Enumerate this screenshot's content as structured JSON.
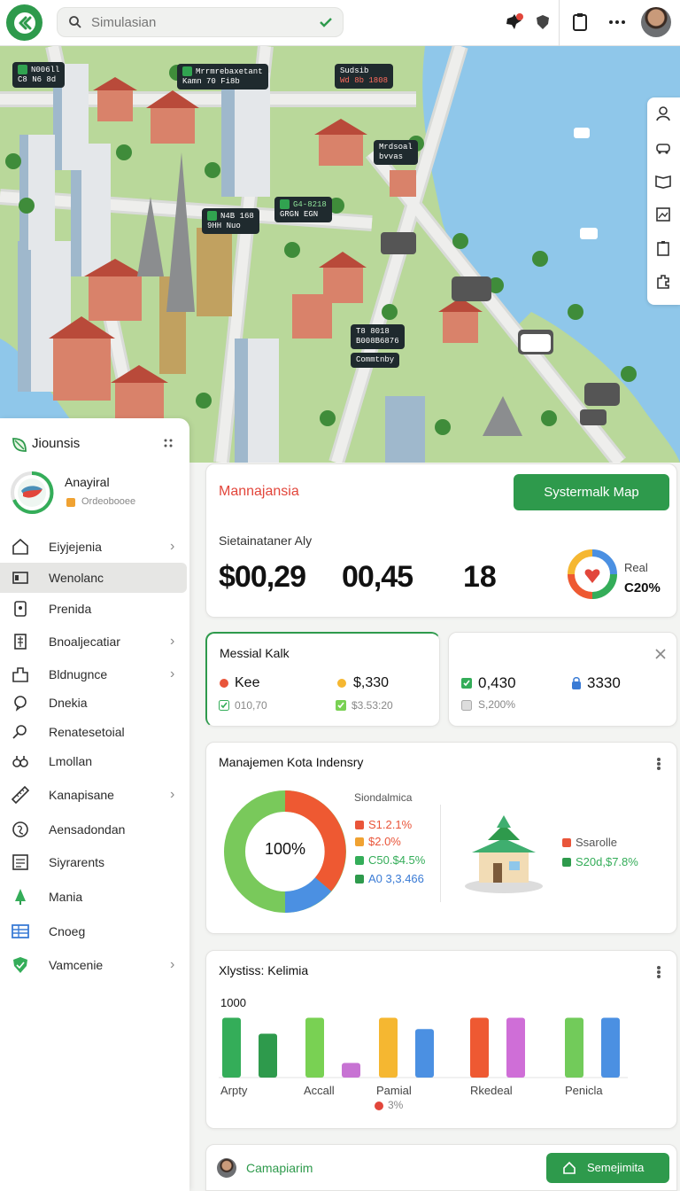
{
  "topbar": {
    "search_placeholder": "Simulasian"
  },
  "map": {
    "labels": [
      {
        "l1": "N006ll",
        "l2": "C8 N6 8d"
      },
      {
        "l1": "Mrrmrebaxetant",
        "l2": "Kamn 70 Fi8b"
      },
      {
        "l1": "Sudsib",
        "l2": "Wd 8b 1808"
      },
      {
        "l1": "Mrdsoal",
        "l2": "bvvas"
      },
      {
        "l1": "N4B 168",
        "l2": "9HH Nuo"
      },
      {
        "l1": "G4-8218",
        "l2": "GRGN EGN"
      },
      {
        "l1": "T8 8018",
        "l2": "B008B6876"
      },
      {
        "l1": "Commtnby",
        "l2": ""
      }
    ]
  },
  "sidebar": {
    "brand": "Jiounsis",
    "profile_name": "Anayiral",
    "profile_sub": "Ordeobooee",
    "items": [
      {
        "label": "Eiyjejenia",
        "icon": "home-icon",
        "chevron": true
      },
      {
        "label": "Wenolanc",
        "icon": "layout-icon",
        "chevron": false
      },
      {
        "label": "Prenida",
        "icon": "document-icon",
        "chevron": false
      },
      {
        "label": "Bnoaljecatiar",
        "icon": "clipboard-icon",
        "chevron": true
      },
      {
        "label": "Bldnugnce",
        "icon": "building-icon",
        "chevron": true
      },
      {
        "label": "Dnekia",
        "icon": "chat-icon",
        "chevron": false
      },
      {
        "label": "Renatesetoial",
        "icon": "search-icon",
        "chevron": false
      },
      {
        "label": "Lmollan",
        "icon": "binoculars-icon",
        "chevron": false
      },
      {
        "label": "Kanapisane",
        "icon": "ruler-icon",
        "chevron": true
      },
      {
        "label": "Aensadondan",
        "icon": "globe-icon",
        "chevron": false
      },
      {
        "label": "Siyrarents",
        "icon": "list-icon",
        "chevron": false
      },
      {
        "label": "Mania",
        "icon": "tree-icon",
        "chevron": false
      },
      {
        "label": "Cnoeg",
        "icon": "table-icon",
        "chevron": false
      },
      {
        "label": "Vamcenie",
        "icon": "shield-icon",
        "chevron": true
      }
    ]
  },
  "summary": {
    "title": "Mannajansia",
    "button": "Systermalk Map",
    "subtitle": "Sietainataner Aly",
    "v1": "$00,29",
    "v2": "00,45",
    "v3": "18",
    "gauge_label": "Real",
    "gauge_value": "C20%"
  },
  "card_left": {
    "title": "Messial Kalk",
    "a_label": "Kee",
    "a_sub": "010,70",
    "b_label": "$,330",
    "b_sub": "$3.53:20"
  },
  "card_right": {
    "a_label": "0,430",
    "a_sub": "S,200%",
    "b_label": "3330"
  },
  "donut_card": {
    "title": "Manajemen Kota Indensry",
    "center": "100%",
    "legend_title": "Siondalmica",
    "legend": [
      {
        "label": "S1.2.1%",
        "color": "#e9553a"
      },
      {
        "label": "$2.0%",
        "color": "#e9553a"
      },
      {
        "label": "C50.$4.5%",
        "color": "#2e9a4c"
      },
      {
        "label": "A0 3,3.466",
        "color": "#2e9a4c"
      }
    ],
    "right_legend": [
      {
        "label": "Ssarolle",
        "color": "#e9553a"
      },
      {
        "label": "S20d,$7.8%",
        "color": "#2e9a4c"
      }
    ]
  },
  "bar_card": {
    "title": "Xlystiss: Kelimia",
    "y_top": "1000",
    "groups": [
      "Arpty",
      "Accall",
      "Pamial",
      "Rkedeal",
      "Penicla"
    ],
    "note": "3%"
  },
  "chart_data": {
    "type": "bar",
    "ylim": [
      0,
      1000
    ],
    "categories": [
      "Arpty",
      "Accall",
      "Pamial",
      "Rkedeal",
      "Penicla"
    ],
    "bars": [
      {
        "group": 0,
        "value": 900,
        "color": "#34ad59"
      },
      {
        "group": 0,
        "value": 660,
        "color": "#2e9a4c"
      },
      {
        "group": 1,
        "value": 900,
        "color": "#79d153"
      },
      {
        "group": 1,
        "value": 220,
        "color": "#c773d3"
      },
      {
        "group": 2,
        "value": 900,
        "color": "#f5b731"
      },
      {
        "group": 2,
        "value": 730,
        "color": "#4b90e2"
      },
      {
        "group": 3,
        "value": 900,
        "color": "#ee5932"
      },
      {
        "group": 3,
        "value": 900,
        "color": "#cf6ed7"
      },
      {
        "group": 4,
        "value": 900,
        "color": "#72cb5a"
      },
      {
        "group": 4,
        "value": 900,
        "color": "#4b90e2"
      }
    ]
  },
  "footer": {
    "label": "Camapiarim",
    "button": "Semejimita"
  }
}
